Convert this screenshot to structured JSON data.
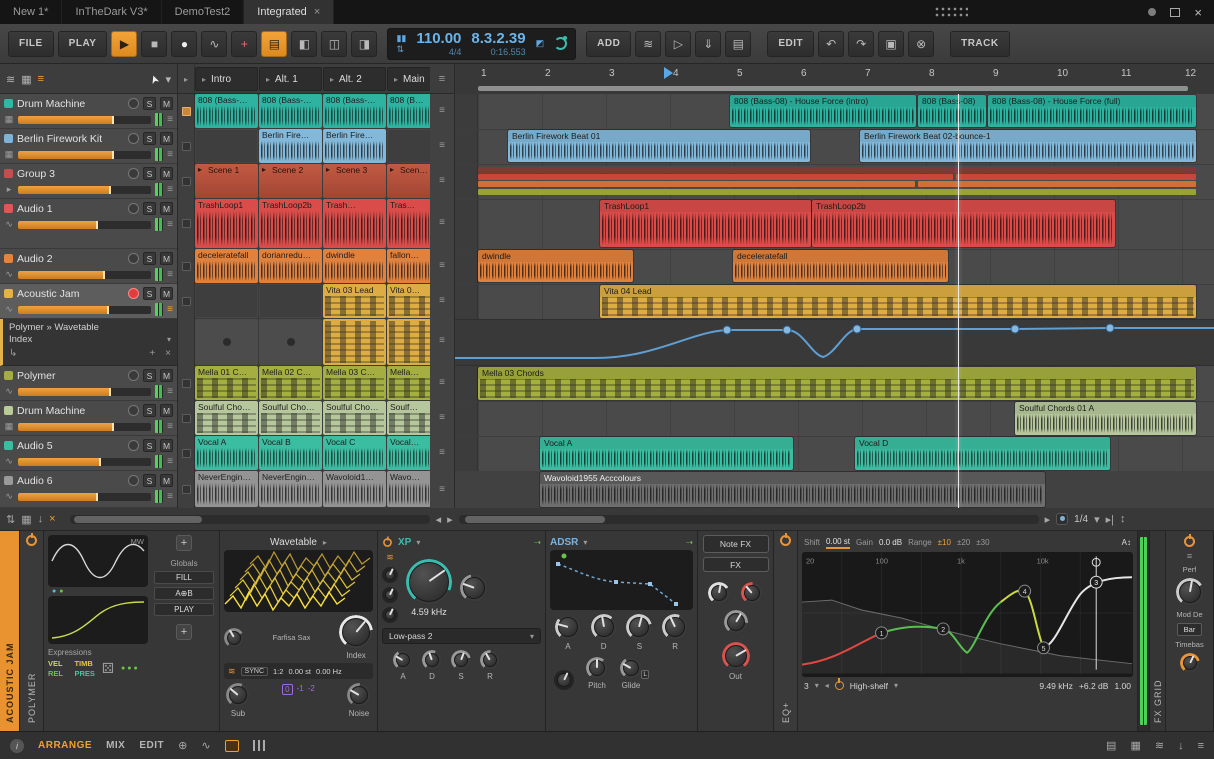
{
  "titlebar": {
    "tabs": [
      {
        "label": "New 1*"
      },
      {
        "label": "InTheDark V3*"
      },
      {
        "label": "DemoTest2"
      },
      {
        "label": "Integrated"
      }
    ]
  },
  "toolbar": {
    "file": "FILE",
    "play": "PLAY",
    "add": "ADD",
    "edit": "EDIT",
    "track": "TRACK",
    "tempo": "110.00",
    "time_signature": "4/4",
    "position": "8.3.2.39",
    "time": "0:16.553"
  },
  "labels": {
    "solo": "S",
    "mute": "M"
  },
  "tracks": [
    {
      "name": "Drum Machine",
      "color": "#2fb9a5"
    },
    {
      "name": "Berlin Firework Kit",
      "color": "#7fb4d8"
    },
    {
      "name": "Group 3",
      "color": "#c05050"
    },
    {
      "name": "Audio 1",
      "color": "#e05555"
    },
    {
      "name": "Audio 2",
      "color": "#e8833c"
    },
    {
      "name": "Acoustic Jam",
      "color": "#e3b34a"
    },
    {
      "name": "Polymer",
      "color": "#a3ad42"
    },
    {
      "name": "Drum Machine",
      "color": "#b9cb96"
    },
    {
      "name": "Audio 5",
      "color": "#3cbca0"
    },
    {
      "name": "Audio 6",
      "color": "#9a9a9a"
    }
  ],
  "device_chain": {
    "line1": "Polymer » Wavetable",
    "line2": "Index"
  },
  "launcher": {
    "scenes": [
      "Intro",
      "Alt. 1",
      "Alt. 2",
      "Main"
    ],
    "rows": [
      {
        "slots": [
          "808 (Bass-…",
          "808 (Bass-…",
          "808 (Bass-…",
          "808 (B…"
        ]
      },
      {
        "slots": [
          "",
          "Berlin Fire…",
          "Berlin Fire…",
          ""
        ]
      },
      {
        "slots": [
          "Scene 1",
          "Scene 2",
          "Scene 3",
          "Scen…"
        ]
      },
      {
        "slots": [
          "TrashLoop1",
          "TrashLoop2b",
          "Trash…",
          "Tras…"
        ]
      },
      {
        "slots": [
          "deceleratefall",
          "dorianredu…",
          "dwindle",
          "fallon…"
        ]
      },
      {
        "slots": [
          "",
          "",
          "Vita 03 Lead",
          "Vita 0…"
        ]
      },
      {
        "slots": [
          "Mella 01 C…",
          "Mella 02 C…",
          "Mella 03 C…",
          "Mella…"
        ]
      },
      {
        "slots": [
          "Soulful Cho…",
          "Soulful Cho…",
          "Soulful Cho…",
          "Soulf…"
        ]
      },
      {
        "slots": [
          "Vocal A",
          "Vocal B",
          "Vocal C",
          "Vocal…"
        ]
      },
      {
        "slots": [
          "NeverEngin…",
          "NeverEngin…",
          "Wavoloid1…",
          "Wavo…"
        ]
      }
    ]
  },
  "arranger": {
    "beats": [
      "1",
      "2",
      "3",
      "4",
      "5",
      "6",
      "7",
      "8",
      "9",
      "10",
      "11",
      "12"
    ],
    "grid_value": "1/4",
    "clips": [
      {
        "label": "808 (Bass-08) - House Force (intro)"
      },
      {
        "label": "808 (Bass-08)"
      },
      {
        "label": "808 (Bass-08) - House Force (full)"
      },
      {
        "label": "Berlin Firework Beat 01"
      },
      {
        "label": "Berlin Firework Beat 02-bounce-1"
      },
      {
        "label": "TrashLoop1"
      },
      {
        "label": "TrashLoop2b"
      },
      {
        "label": "dwindle"
      },
      {
        "label": "deceleratefall"
      },
      {
        "label": "Vita 04 Lead"
      },
      {
        "label": "Mella 03 Chords"
      },
      {
        "label": "Soulful Chords 01 A"
      },
      {
        "label": "Vocal A"
      },
      {
        "label": "Vocal D"
      },
      {
        "label": "Wavoloid1955 Acccolours"
      }
    ]
  },
  "device": {
    "track_label": "ACOUSTIC JAM",
    "polymer": {
      "name": "POLYMER",
      "mw": "MW",
      "globals_title": "Globals",
      "fill": "FILL",
      "ab": "A⊕B",
      "play": "PLAY",
      "expressions_title": "Expressions",
      "vel": "VEL",
      "timb": "TIMB",
      "rel": "REL",
      "pres": "PRES",
      "osc_title": "Wavetable",
      "preset": "Farfisa Sax",
      "index": "Index",
      "sync": "SYNC",
      "ratio": "1:2",
      "semitones": "0.00 st",
      "hertz": "0.00 Hz",
      "sub": "Sub",
      "octaves": [
        "0",
        "-1",
        "-2"
      ],
      "noise": "Noise",
      "filter_title": "XP",
      "cutoff": "4.59 kHz",
      "filter_type": "Low-pass 2",
      "adsr_title": "ADSR",
      "a": "A",
      "d": "D",
      "s": "S",
      "r": "R",
      "note_fx": "Note FX",
      "fx": "FX",
      "pitch": "Pitch",
      "glide": "Glide",
      "out": "Out"
    },
    "eq": {
      "name": "EQ+",
      "shift_label": "Shift",
      "shift_value": "0.00 st",
      "gain_label": "Gain",
      "gain_value": "0.0 dB",
      "range_label": "Range",
      "range_options": [
        "±10",
        "±20",
        "±30"
      ],
      "freq_ticks": [
        "20",
        "100",
        "1k",
        "10k"
      ],
      "points": [
        "1",
        "2",
        "3",
        "4",
        "5"
      ],
      "ab_label": "A",
      "band_count": "3",
      "band_type": "High-shelf",
      "band_freq": "9.49 kHz",
      "band_gain": "+6.2 dB",
      "band_q": "1.00"
    },
    "right": {
      "fx_grid": "FX GRID",
      "perf": "Perf",
      "mod": "Mod De",
      "bar": "Bar",
      "timebase": "Timebas"
    }
  },
  "statusbar": {
    "arrange": "ARRANGE",
    "mix": "MIX",
    "edit": "EDIT"
  },
  "colors": {
    "accent_orange": "#f0a030",
    "accent_blue": "#6ab4ea",
    "clip_teal": "#2db3a0",
    "clip_blue": "#82b9da",
    "clip_red": "#d94c49",
    "clip_orange": "#e0823e",
    "clip_yellow": "#ddad43",
    "clip_olive": "#a4ae41",
    "clip_sage": "#b6c79b",
    "clip_vocal_teal": "#3abda1",
    "clip_gray": "#949494",
    "meter_green": "#4ecf58"
  },
  "icons": {
    "close": "×",
    "dot": "●",
    "play": "▶",
    "stop": "■",
    "record": "●",
    "write": "∿",
    "punch": "+",
    "overdub": "▤",
    "panel_left": "◧",
    "panel_bottom": "◫",
    "panel_right": "◨",
    "metronome": "▮▮",
    "tap": "⇅",
    "io": "◩",
    "add_device": "≋",
    "follow": "▷",
    "insert": "⇓",
    "browser": "▤",
    "undo": "↶",
    "redo": "↷",
    "duplicate": "▣",
    "delete": "⊗",
    "list": "≋",
    "grid": "▦",
    "menu": "≡",
    "pointer": "➤",
    "chev_down": "▾",
    "chev_right": "▸",
    "chev_left": "◂",
    "swap": "⇅",
    "download": "↓",
    "updown": "↕",
    "to_end": "▸|",
    "info": "i",
    "plus": "+",
    "minus": "−",
    "dice": "⚄",
    "sub_chain": "↳",
    "arrow_right": "⇢",
    "snap": "⊕",
    "track_drum": "▦",
    "track_audio": "∿",
    "track_group": "▸"
  }
}
